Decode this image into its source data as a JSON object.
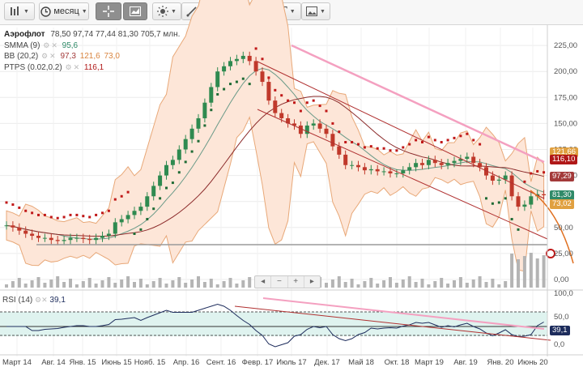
{
  "toolbar": {
    "period_label": "месяц",
    "buttons": [
      "menu",
      "period",
      "crosshair",
      "chart-type",
      "indicators",
      "draw-line",
      "shapes",
      "fibonacci",
      "text",
      "image"
    ]
  },
  "instrument": {
    "name": "Аэрофлот",
    "open": "78,50",
    "high": "97,74",
    "low": "77,44",
    "close": "81,30",
    "volume": "705,7 млн."
  },
  "indicators": [
    {
      "label": "SMMA (9)",
      "values": [
        "95,6"
      ],
      "colors": [
        "#2f8a68"
      ]
    },
    {
      "label": "BB (20,2)",
      "values": [
        "97,3",
        "121,6",
        "73,0"
      ],
      "colors": [
        "#a33a3a",
        "#d9843f",
        "#d9843f"
      ]
    },
    {
      "label": "PTPS (0.02,0.2)",
      "values": [
        "116,1"
      ],
      "colors": [
        "#b01818"
      ]
    }
  ],
  "rsi": {
    "label": "RSI (14)",
    "value": "39,1",
    "color": "#1d2c5c"
  },
  "y_axis": [
    "225,00",
    "200,00",
    "175,00",
    "150,00",
    "125,00",
    "100,00",
    "75,00",
    "50,00",
    "25,00",
    "0,00"
  ],
  "rsi_axis": [
    "100,0",
    "50,0",
    "0,0"
  ],
  "x_axis": [
    "Март 14",
    "Авг. 14",
    "Янв. 15",
    "Июнь 15",
    "Нояб. 15",
    "Апр. 16",
    "Сент. 16",
    "Февр. 17",
    "Июль 17",
    "Дек. 17",
    "Май 18",
    "Окт. 18",
    "Март 19",
    "Авг. 19",
    "Янв. 20",
    "Июнь 20"
  ],
  "price_tags": [
    {
      "text": "121,66",
      "color": "#e0a040"
    },
    {
      "text": "116,10",
      "color": "#b01818"
    },
    {
      "text": "97,29",
      "color": "#a33a3a"
    },
    {
      "text": "81,30",
      "color": "#2f8a68"
    },
    {
      "text": "73,02",
      "color": "#e0a040"
    }
  ],
  "rsi_tag": {
    "text": "39,1",
    "color": "#1d2c5c"
  },
  "zoom": [
    "◂",
    "−",
    "+",
    "▸"
  ],
  "colors": {
    "bull": "#2f8a50",
    "bear": "#c0392b",
    "band_fill": "#fde6d8",
    "band_line": "#e8a878",
    "smma": "#6a9a88",
    "bb_mid": "#8b2a2a",
    "parabolic": "#c01818",
    "trend_pink": "#f4a0c0",
    "volume": "#b4b4b4",
    "rsi_fill": "#dff3ef"
  }
}
